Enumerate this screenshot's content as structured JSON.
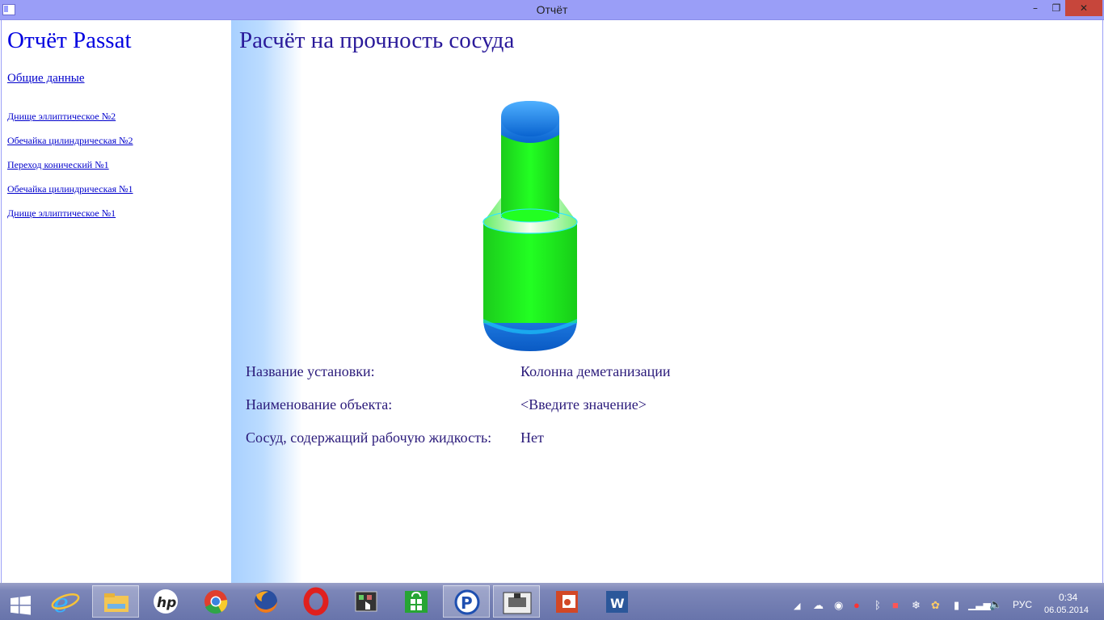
{
  "window": {
    "title": "Отчёт",
    "min": "–",
    "max": "❐",
    "close": "✕"
  },
  "nav": {
    "title": "Отчёт Passat",
    "general": "Общие данные",
    "items": [
      "Днище эллиптическое №2",
      "Обечайка цилиндрическая №2",
      "Переход конический №1",
      "Обечайка цилиндрическая №1",
      "Днище эллиптическое №1"
    ]
  },
  "main": {
    "title": "Расчёт на прочность сосуда",
    "rows": [
      {
        "label": "Название установки:",
        "value": "Колонна деметанизации"
      },
      {
        "label": "Наименование объекта:",
        "value": "<Введите значение>"
      },
      {
        "label": "Сосуд, содержащий рабочую жидкость:",
        "value": "Нет"
      }
    ]
  },
  "taskbar": {
    "apps": [
      "windows-start",
      "internet-explorer",
      "file-explorer",
      "hp",
      "chrome",
      "firefox",
      "opera",
      "app-touch",
      "store",
      "passat",
      "vessel-app",
      "powerpoint",
      "word"
    ],
    "tray": {
      "lang": "РУС",
      "time": "0:34",
      "date": "06.05.2014"
    }
  },
  "colors": {
    "vessel_green": "#22ee22",
    "vessel_blue": "#1e88f0",
    "title_bar": "#9a9ef7"
  }
}
